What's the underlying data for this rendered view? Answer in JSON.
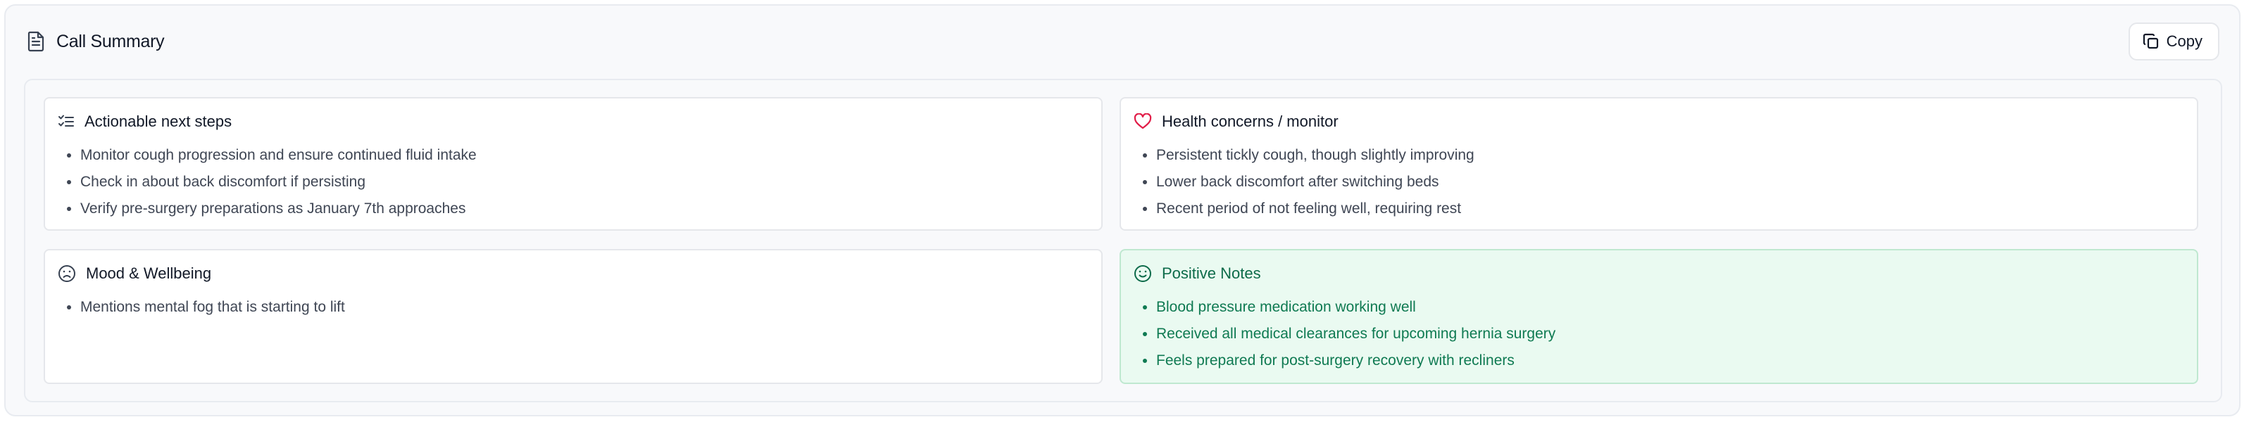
{
  "header": {
    "title": "Call Summary",
    "title_icon": "document-icon",
    "copy_label": "Copy",
    "copy_icon": "copy-icon"
  },
  "cards": {
    "next_steps": {
      "title": "Actionable next steps",
      "icon": "checklist-icon",
      "items": [
        "Monitor cough progression and ensure continued fluid intake",
        "Check in about back discomfort if persisting",
        "Verify pre-surgery preparations as January 7th approaches"
      ]
    },
    "health": {
      "title": "Health concerns / monitor",
      "icon": "heart-icon",
      "items": [
        "Persistent tickly cough, though slightly improving",
        "Lower back discomfort after switching beds",
        "Recent period of not feeling well, requiring rest"
      ]
    },
    "mood": {
      "title": "Mood & Wellbeing",
      "icon": "frown-face-icon",
      "items": [
        "Mentions mental fog that is starting to lift"
      ]
    },
    "positive": {
      "title": "Positive Notes",
      "icon": "smile-face-icon",
      "items": [
        "Blood pressure medication working well",
        "Received all medical clearances for upcoming hernia surgery",
        "Feels prepared for post-surgery recovery with recliners"
      ]
    }
  },
  "colors": {
    "heart": "#e11d48",
    "positive_bg": "#eafaf1",
    "positive_text": "#0f7a52",
    "border": "#e5e7eb"
  }
}
